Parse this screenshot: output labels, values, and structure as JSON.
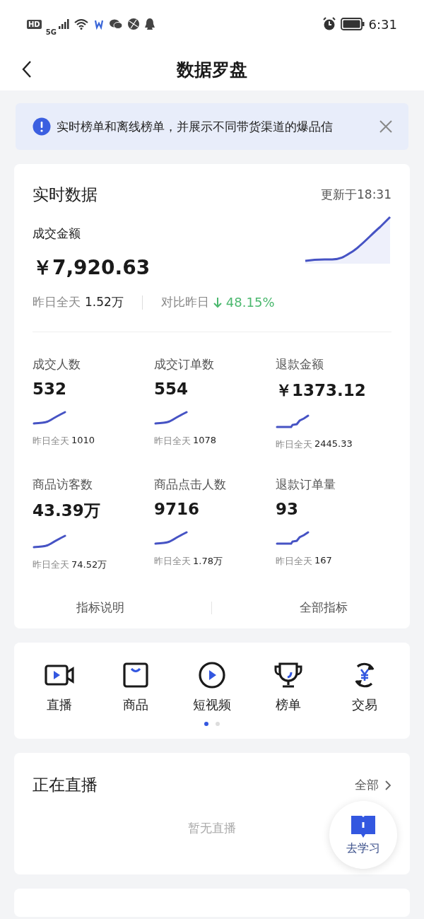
{
  "status_bar": {
    "badges": [
      "HD",
      "5G"
    ],
    "time": "6:31"
  },
  "header": {
    "title": "数据罗盘"
  },
  "notice": {
    "text": "实时榜单和离线榜单，并展示不同带货渠道的爆品信"
  },
  "realtime": {
    "title": "实时数据",
    "updated": "更新于18:31",
    "main": {
      "label": "成交金额",
      "value": "￥7,920.63",
      "yesterday_label": "昨日全天",
      "yesterday_value": "1.52万",
      "compare_label": "对比昨日",
      "change": {
        "kind": "down",
        "value": "48.15%"
      }
    },
    "metrics": [
      {
        "label": "成交人数",
        "value": "532",
        "yesterday_label": "昨日全天",
        "yesterday_value": "1010",
        "kind": "smooth"
      },
      {
        "label": "成交订单数",
        "value": "554",
        "yesterday_label": "昨日全天",
        "yesterday_value": "1078",
        "kind": "smooth"
      },
      {
        "label": "退款金额",
        "value": "￥1373.12",
        "yesterday_label": "昨日全天",
        "yesterday_value": "2445.33",
        "kind": "step"
      },
      {
        "label": "商品访客数",
        "value": "43.39万",
        "yesterday_label": "昨日全天",
        "yesterday_value": "74.52万",
        "kind": "smooth"
      },
      {
        "label": "商品点击人数",
        "value": "9716",
        "yesterday_label": "昨日全天",
        "yesterday_value": "1.78万",
        "kind": "smooth"
      },
      {
        "label": "退款订单量",
        "value": "93",
        "yesterday_label": "昨日全天",
        "yesterday_value": "167",
        "kind": "step"
      }
    ],
    "links": [
      "指标说明",
      "全部指标"
    ]
  },
  "shortcuts": {
    "items": [
      {
        "kind": "live",
        "label": "直播"
      },
      {
        "kind": "goods",
        "label": "商品"
      },
      {
        "kind": "video",
        "label": "短视频"
      },
      {
        "kind": "rank",
        "label": "榜单"
      },
      {
        "kind": "trade",
        "label": "交易"
      }
    ],
    "pages": [
      {
        "selected": true
      },
      {
        "selected": false
      }
    ]
  },
  "live": {
    "title": "正在直播",
    "all": "全部",
    "empty": "暂无直播"
  },
  "fab": {
    "label": "去学习"
  }
}
